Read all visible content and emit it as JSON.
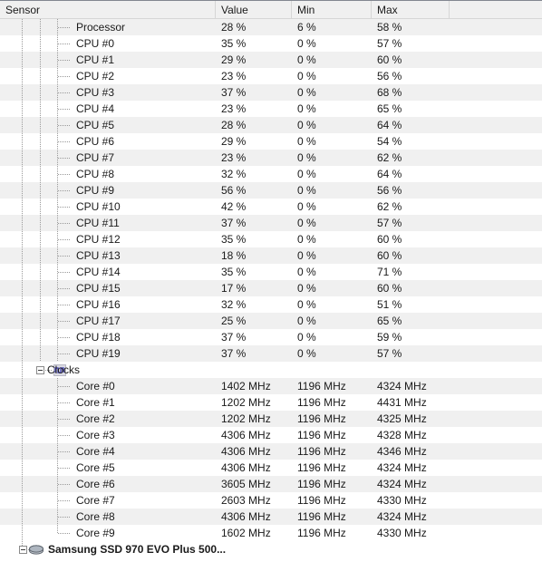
{
  "header": {
    "columns": [
      {
        "label": "Sensor",
        "key": "sensor"
      },
      {
        "label": "Value",
        "key": "value"
      },
      {
        "label": "Min",
        "key": "min"
      },
      {
        "label": "Max",
        "key": "max"
      },
      {
        "label": "",
        "key": "spare"
      }
    ]
  },
  "tree": {
    "groups": [
      {
        "name": "load-group",
        "rows": [
          {
            "label": "Processor",
            "value": "28 %",
            "min": "6 %",
            "max": "58 %"
          },
          {
            "label": "CPU #0",
            "value": "35 %",
            "min": "0 %",
            "max": "57 %"
          },
          {
            "label": "CPU #1",
            "value": "29 %",
            "min": "0 %",
            "max": "60 %"
          },
          {
            "label": "CPU #2",
            "value": "23 %",
            "min": "0 %",
            "max": "56 %"
          },
          {
            "label": "CPU #3",
            "value": "37 %",
            "min": "0 %",
            "max": "68 %"
          },
          {
            "label": "CPU #4",
            "value": "23 %",
            "min": "0 %",
            "max": "65 %"
          },
          {
            "label": "CPU #5",
            "value": "28 %",
            "min": "0 %",
            "max": "64 %"
          },
          {
            "label": "CPU #6",
            "value": "29 %",
            "min": "0 %",
            "max": "54 %"
          },
          {
            "label": "CPU #7",
            "value": "23 %",
            "min": "0 %",
            "max": "62 %"
          },
          {
            "label": "CPU #8",
            "value": "32 %",
            "min": "0 %",
            "max": "64 %"
          },
          {
            "label": "CPU #9",
            "value": "56 %",
            "min": "0 %",
            "max": "56 %"
          },
          {
            "label": "CPU #10",
            "value": "42 %",
            "min": "0 %",
            "max": "62 %"
          },
          {
            "label": "CPU #11",
            "value": "37 %",
            "min": "0 %",
            "max": "57 %"
          },
          {
            "label": "CPU #12",
            "value": "35 %",
            "min": "0 %",
            "max": "60 %"
          },
          {
            "label": "CPU #13",
            "value": "18 %",
            "min": "0 %",
            "max": "60 %"
          },
          {
            "label": "CPU #14",
            "value": "35 %",
            "min": "0 %",
            "max": "71 %"
          },
          {
            "label": "CPU #15",
            "value": "17 %",
            "min": "0 %",
            "max": "60 %"
          },
          {
            "label": "CPU #16",
            "value": "32 %",
            "min": "0 %",
            "max": "51 %"
          },
          {
            "label": "CPU #17",
            "value": "25 %",
            "min": "0 %",
            "max": "65 %"
          },
          {
            "label": "CPU #18",
            "value": "37 %",
            "min": "0 %",
            "max": "59 %"
          },
          {
            "label": "CPU #19",
            "value": "37 %",
            "min": "0 %",
            "max": "57 %"
          }
        ]
      }
    ],
    "clocks_group": {
      "label": "Clocks",
      "icon": "clock-waveform-icon",
      "expander": "minus-expander",
      "rows": [
        {
          "label": "Core #0",
          "value": "1402 MHz",
          "min": "1196 MHz",
          "max": "4324 MHz"
        },
        {
          "label": "Core #1",
          "value": "1202 MHz",
          "min": "1196 MHz",
          "max": "4431 MHz"
        },
        {
          "label": "Core #2",
          "value": "1202 MHz",
          "min": "1196 MHz",
          "max": "4325 MHz"
        },
        {
          "label": "Core #3",
          "value": "4306 MHz",
          "min": "1196 MHz",
          "max": "4328 MHz"
        },
        {
          "label": "Core #4",
          "value": "4306 MHz",
          "min": "1196 MHz",
          "max": "4346 MHz"
        },
        {
          "label": "Core #5",
          "value": "4306 MHz",
          "min": "1196 MHz",
          "max": "4324 MHz"
        },
        {
          "label": "Core #6",
          "value": "3605 MHz",
          "min": "1196 MHz",
          "max": "4324 MHz"
        },
        {
          "label": "Core #7",
          "value": "2603 MHz",
          "min": "1196 MHz",
          "max": "4330 MHz"
        },
        {
          "label": "Core #8",
          "value": "4306 MHz",
          "min": "1196 MHz",
          "max": "4324 MHz"
        },
        {
          "label": "Core #9",
          "value": "1602 MHz",
          "min": "1196 MHz",
          "max": "4330 MHz"
        }
      ]
    },
    "device_node": {
      "label": "Samsung SSD 970 EVO Plus 500...",
      "icon": "hard-disk-icon",
      "expander": "minus-expander"
    }
  },
  "colors": {
    "row_stripe": "#f0f0f0",
    "row_plain": "#ffffff",
    "header_bg": "#f0f0f0",
    "grid_line": "#d6d6d6",
    "text": "#1a1a1a",
    "tree_line": "#9a9a9a",
    "clock_icon_accent": "#4a4ab4"
  }
}
